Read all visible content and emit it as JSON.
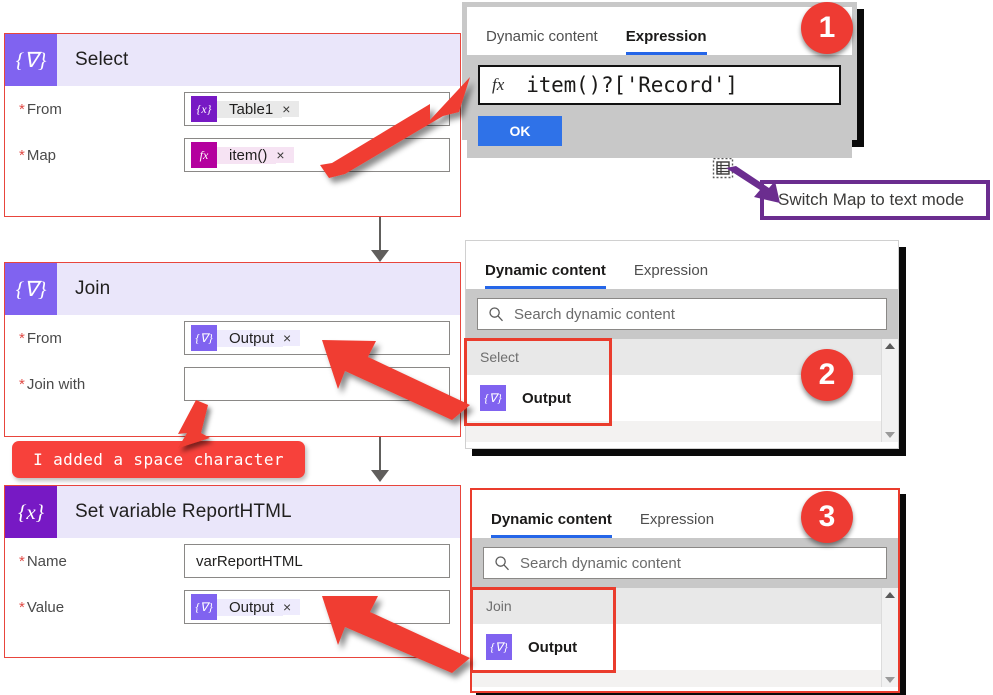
{
  "flow": {
    "cards": [
      {
        "id": "select",
        "icon_glyph": "{∇}",
        "icon_name": "select-action-icon",
        "title": "Select",
        "fields": [
          {
            "label": "From",
            "required": true,
            "kind": "chip",
            "chip_type": "var",
            "chip_icon": "{x}",
            "chip_text": "Table1",
            "chip_close": "×"
          },
          {
            "label": "Map",
            "required": true,
            "kind": "chip",
            "chip_type": "expr",
            "chip_icon": "fx",
            "chip_text": "item()",
            "chip_close": "×"
          }
        ]
      },
      {
        "id": "join",
        "icon_glyph": "{∇}",
        "icon_name": "join-action-icon",
        "title": "Join",
        "fields": [
          {
            "label": "From",
            "required": true,
            "kind": "chip",
            "chip_type": "out",
            "chip_icon": "{∇}",
            "chip_text": "Output",
            "chip_close": "×"
          },
          {
            "label": "Join with",
            "required": true,
            "kind": "empty",
            "value": ""
          }
        ]
      },
      {
        "id": "setvariable",
        "icon_glyph": "{x}",
        "icon_name": "set-variable-icon",
        "title": "Set variable ReportHTML",
        "fields": [
          {
            "label": "Name",
            "required": true,
            "kind": "text",
            "value": "varReportHTML"
          },
          {
            "label": "Value",
            "required": true,
            "kind": "chip",
            "chip_type": "out",
            "chip_icon": "{∇}",
            "chip_text": "Output",
            "chip_close": "×"
          }
        ]
      }
    ]
  },
  "popups": {
    "expression": {
      "badge": "1",
      "tabs": [
        {
          "label": "Dynamic content",
          "active": false
        },
        {
          "label": "Expression",
          "active": true
        }
      ],
      "fx_symbol": "fx",
      "value": "item()?['Record']",
      "ok_label": "OK"
    },
    "dynamic_select": {
      "badge": "2",
      "tabs": [
        {
          "label": "Dynamic content",
          "active": true
        },
        {
          "label": "Expression",
          "active": false
        }
      ],
      "search_placeholder": "Search dynamic content",
      "group_label": "Select",
      "item_icon": "{∇}",
      "item_label": "Output"
    },
    "dynamic_join": {
      "badge": "3",
      "tabs": [
        {
          "label": "Dynamic content",
          "active": true
        },
        {
          "label": "Expression",
          "active": false
        }
      ],
      "search_placeholder": "Search dynamic content",
      "group_label": "Join",
      "item_icon": "{∇}",
      "item_label": "Output"
    }
  },
  "annotations": {
    "switch_map_text": "Switch Map to text mode",
    "space_character": "I added a space character"
  },
  "colors": {
    "action_violet": "#8063f0",
    "action_deep_purple": "#7719c4",
    "expression_magenta": "#b4009e",
    "card_header_bg": "#eae6fa",
    "annotation_red": "#ee3b33",
    "annotation_purple": "#6b2d8f",
    "tab_underline_blue": "#2566e8",
    "ok_button_blue": "#2f72e8"
  }
}
